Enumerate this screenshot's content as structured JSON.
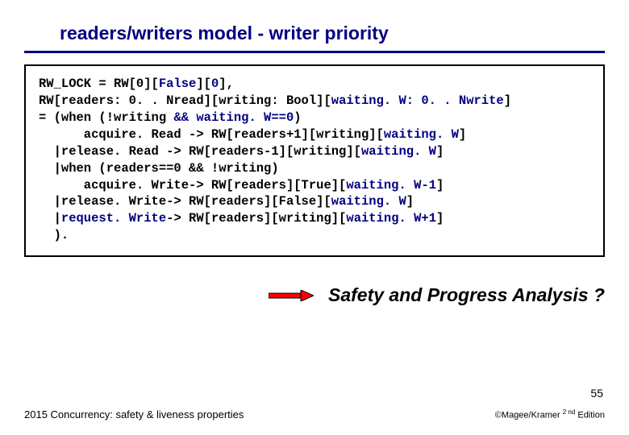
{
  "title": "readers/writers model - writer priority",
  "code": {
    "l1a": "RW_LOCK = RW[0][",
    "l1b": "False",
    "l1c": "][",
    "l1d": "0",
    "l1e": "],",
    "l2a": "RW[readers: 0. . Nread][writing: Bool][",
    "l2b": "waiting. W: 0. . Nwrite",
    "l2c": "]",
    "l3a": "= (when (!writing ",
    "l3b": "&& waiting. W==0",
    "l3c": ")",
    "l4a": "      acquire. Read -> RW[readers+1][writing][",
    "l4b": "waiting. W",
    "l4c": "]",
    "l5a": "  |release. Read -> RW[readers-1][writing][",
    "l5b": "waiting. W",
    "l5c": "]",
    "l6": "  |when (readers==0 && !writing)",
    "l7a": "      acquire. Write-> RW[readers][True][",
    "l7b": "waiting. W-1",
    "l7c": "]",
    "l8a": "  |release. Write-> RW[readers][False][",
    "l8b": "waiting. W",
    "l8c": "]",
    "l9a": "  |",
    "l9b": "request. Write",
    "l9c": "-> RW[readers][writing][",
    "l9d": "waiting. W+1",
    "l9e": "]",
    "l10": "  )."
  },
  "question": "Safety and Progress Analysis ?",
  "page_number": "55",
  "footer_left": "2015  Concurrency: safety & liveness properties",
  "footer_right_pre": "©Magee/Kramer ",
  "footer_right_sup": "2 nd",
  "footer_right_post": " Edition"
}
